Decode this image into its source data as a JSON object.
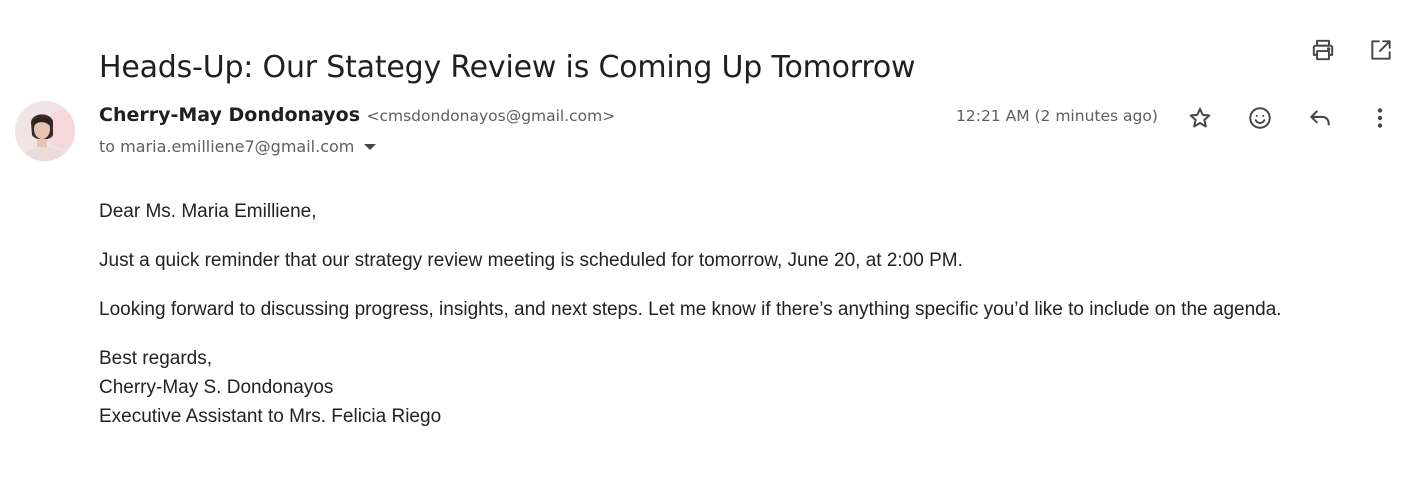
{
  "email": {
    "subject": "Heads-Up: Our Stategy Review is Coming Up Tomorrow",
    "sender_name": "Cherry-May Dondonayos",
    "sender_email": "<cmsdondonayos@gmail.com>",
    "recipient": "to maria.emilliene7@gmail.com",
    "timestamp": "12:21 AM (2 minutes ago)",
    "body": {
      "greeting": "Dear Ms. Maria Emilliene,",
      "paragraph1": "Just a quick reminder that our strategy review meeting is scheduled for tomorrow, June 20, at 2:00 PM.",
      "paragraph2": "Looking forward to discussing progress, insights, and next steps. Let me know if there’s anything specific you’d like to include on the agenda.",
      "closing": "Best regards,",
      "signature_name": "Cherry-May S. Dondonayos",
      "signature_title": "Executive Assistant to Mrs. Felicia Riego"
    }
  },
  "icons": {
    "print": "printer-icon",
    "popout": "open-in-new-window-icon",
    "star": "star-icon",
    "emoji": "emoji-reaction-icon",
    "reply": "reply-icon",
    "more": "more-vertical-icon",
    "recipient_details": "chevron-down-icon"
  },
  "colors": {
    "text_primary": "#1f1f1f",
    "text_secondary": "#5e5e5e",
    "icon": "#444746",
    "background": "#ffffff"
  }
}
